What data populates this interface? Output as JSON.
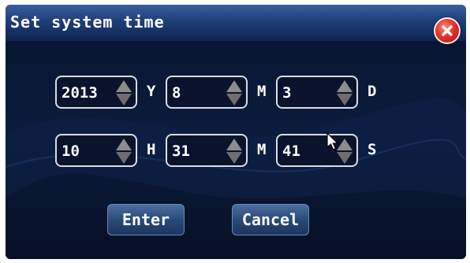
{
  "dialog": {
    "title": "Set system time"
  },
  "date_row": [
    {
      "value": "2013",
      "unit": "Y"
    },
    {
      "value": "8",
      "unit": "M"
    },
    {
      "value": "3",
      "unit": "D"
    }
  ],
  "time_row": [
    {
      "value": "10",
      "unit": "H"
    },
    {
      "value": "31",
      "unit": "M"
    },
    {
      "value": "41",
      "unit": "S"
    }
  ],
  "buttons": {
    "enter": "Enter",
    "cancel": "Cancel"
  },
  "colors": {
    "titlebar": "#1f3e78",
    "background": "#06122a",
    "close": "#e8302a"
  }
}
